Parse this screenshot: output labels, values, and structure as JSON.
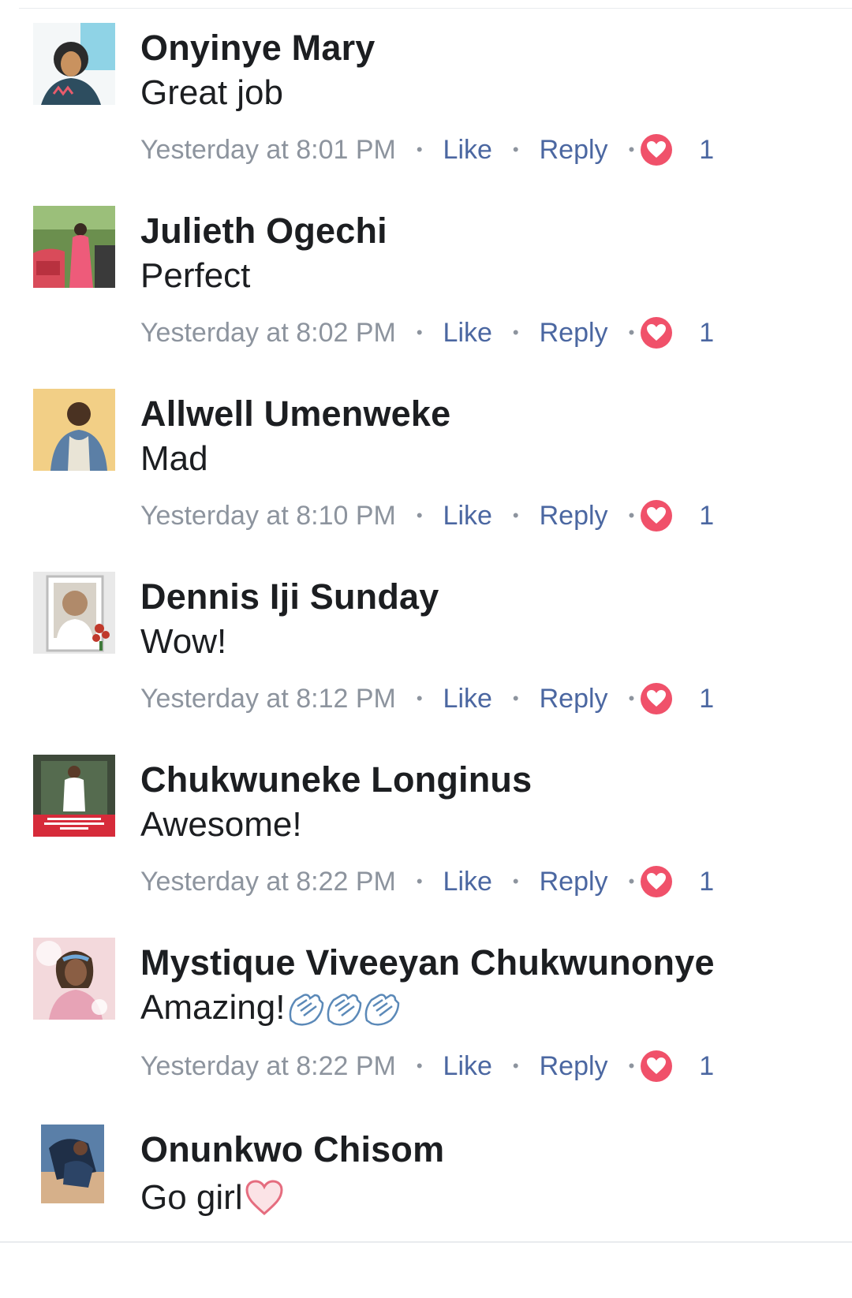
{
  "comments": [
    {
      "name": "Onyinye Mary",
      "text": "Great job",
      "time": "Yesterday at 8:01 PM",
      "like": "Like",
      "reply": "Reply",
      "reactions": "1",
      "avatar_colors": [
        "#8fd3e6",
        "#2b2b2b",
        "#d9a67a"
      ]
    },
    {
      "name": "Julieth Ogechi",
      "text": "Perfect",
      "time": "Yesterday at 8:02 PM",
      "like": "Like",
      "reply": "Reply",
      "reactions": "1",
      "avatar_colors": [
        "#6b8f4e",
        "#d94b5a",
        "#3a3a3a"
      ]
    },
    {
      "name": "Allwell Umenweke",
      "text": "Mad",
      "time": "Yesterday at 8:10 PM",
      "like": "Like",
      "reply": "Reply",
      "reactions": "1",
      "avatar_colors": [
        "#f2cf86",
        "#5b7fa6",
        "#4a3222"
      ]
    },
    {
      "name": "Dennis Iji Sunday",
      "text": "Wow!",
      "time": "Yesterday at 8:12 PM",
      "like": "Like",
      "reply": "Reply",
      "reactions": "1",
      "avatar_colors": [
        "#e9e9e9",
        "#b08a6a",
        "#c0392b"
      ]
    },
    {
      "name": "Chukwuneke Longinus",
      "text": "Awesome!",
      "time": "Yesterday at 8:22 PM",
      "like": "Like",
      "reply": "Reply",
      "reactions": "1",
      "avatar_colors": [
        "#3e4a3a",
        "#ffffff",
        "#d62b3a"
      ]
    },
    {
      "name": "Mystique Viveeyan Chukwunonye",
      "text": "Amazing!",
      "time": "Yesterday at 8:22 PM",
      "like": "Like",
      "reply": "Reply",
      "reactions": "1",
      "avatar_colors": [
        "#f3d9dc",
        "#6b4b3b",
        "#e7a3b6"
      ],
      "emoji": "clapping-hands x3"
    },
    {
      "name": "Onunkwo Chisom",
      "text": "Go girl",
      "avatar_colors": [
        "#5a7fa8",
        "#1f2f47",
        "#d6b08a"
      ],
      "emoji": "heart-outline"
    }
  ],
  "colors": {
    "name": "#1c1e21",
    "meta": "#8d949e",
    "action": "#4b67a1",
    "reaction": "#f0516a"
  }
}
